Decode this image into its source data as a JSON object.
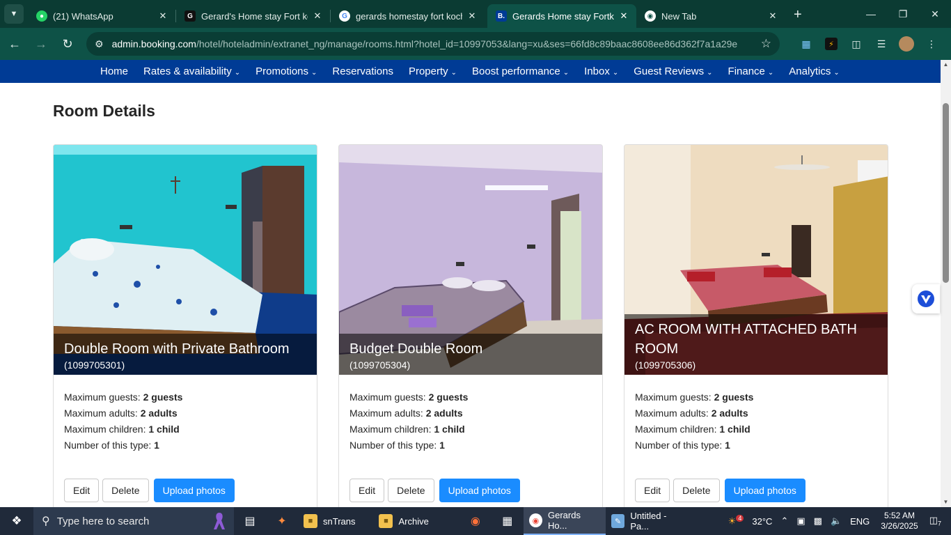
{
  "browser": {
    "tabs": [
      {
        "title": "(21) WhatsApp",
        "favicon": "whatsapp-icon",
        "color": "#25d366"
      },
      {
        "title": "Gerard's Home stay Fort kochi",
        "favicon": "generic-g-icon",
        "color": "#111111"
      },
      {
        "title": "gerards homestay fort kochi",
        "favicon": "google-icon",
        "color": "#ffffff"
      },
      {
        "title": "Gerards Home stay Fortkochi",
        "favicon": "booking-icon",
        "color": "#003b95"
      },
      {
        "title": "New Tab",
        "favicon": "chrome-icon",
        "color": "#ffffff"
      }
    ],
    "active_tab": 3,
    "url_host": "admin.booking.com",
    "url_path": "/hotel/hoteladmin/extranet_ng/manage/rooms.html?hotel_id=10997053&lang=xu&ses=66fd8c89baac8608ee86d362f7a1a29e"
  },
  "nav": {
    "items": [
      {
        "label": "Home",
        "dropdown": false
      },
      {
        "label": "Rates & availability",
        "dropdown": true
      },
      {
        "label": "Promotions",
        "dropdown": true
      },
      {
        "label": "Reservations",
        "dropdown": false
      },
      {
        "label": "Property",
        "dropdown": true
      },
      {
        "label": "Boost performance",
        "dropdown": true
      },
      {
        "label": "Inbox",
        "dropdown": true
      },
      {
        "label": "Guest Reviews",
        "dropdown": true
      },
      {
        "label": "Finance",
        "dropdown": true
      },
      {
        "label": "Analytics",
        "dropdown": true
      }
    ]
  },
  "page": {
    "title": "Room Details",
    "labels": {
      "max_guests": "Maximum guests:",
      "max_adults": "Maximum adults:",
      "max_children": "Maximum children:",
      "num_type": "Number of this type:"
    },
    "buttons": {
      "edit": "Edit",
      "delete": "Delete",
      "upload": "Upload photos"
    },
    "rooms": [
      {
        "name": "Double Room with Private Bathroom",
        "id": "(1099705301)",
        "max_guests": "2 guests",
        "max_adults": "2 adults",
        "max_children": "1 child",
        "num_type": "1",
        "wall": "#21c4cf"
      },
      {
        "name": "Budget Double Room",
        "id": "(1099705304)",
        "max_guests": "2 guests",
        "max_adults": "2 adults",
        "max_children": "1 child",
        "num_type": "1",
        "wall": "#c7b7dc"
      },
      {
        "name": "AC ROOM WITH ATTACHED BATH ROOM",
        "id": "(1099705306)",
        "max_guests": "2 guests",
        "max_adults": "2 adults",
        "max_children": "1 child",
        "num_type": "1",
        "wall": "#eedcc0"
      }
    ]
  },
  "taskbar": {
    "search_placeholder": "Type here to search",
    "apps": [
      {
        "label": "snTrans",
        "icon": "folder-icon"
      },
      {
        "label": "Archive",
        "icon": "folder-icon"
      },
      {
        "label": "Gerards Ho...",
        "icon": "chrome-icon"
      },
      {
        "label": "Untitled - Pa...",
        "icon": "paint-icon"
      }
    ],
    "weather_badge": "4",
    "temperature": "32°C",
    "language": "ENG",
    "time": "5:52 AM",
    "date": "3/26/2025",
    "notifications": "7"
  }
}
